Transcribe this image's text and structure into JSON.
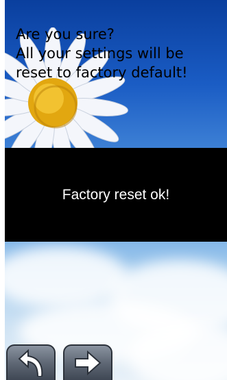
{
  "dialog": {
    "message_line1": "Are you sure?",
    "message_line2": "All your settings will be",
    "message_line3": "reset to factory default!"
  },
  "toast": {
    "text": "Factory reset ok!"
  },
  "nav": {
    "back_icon": "back-arrow-icon",
    "next_icon": "right-arrow-icon"
  },
  "colors": {
    "toast_background": "#000000",
    "toast_text": "#ffffff",
    "sky": "#1a5cc4",
    "button": "#5f6875"
  }
}
